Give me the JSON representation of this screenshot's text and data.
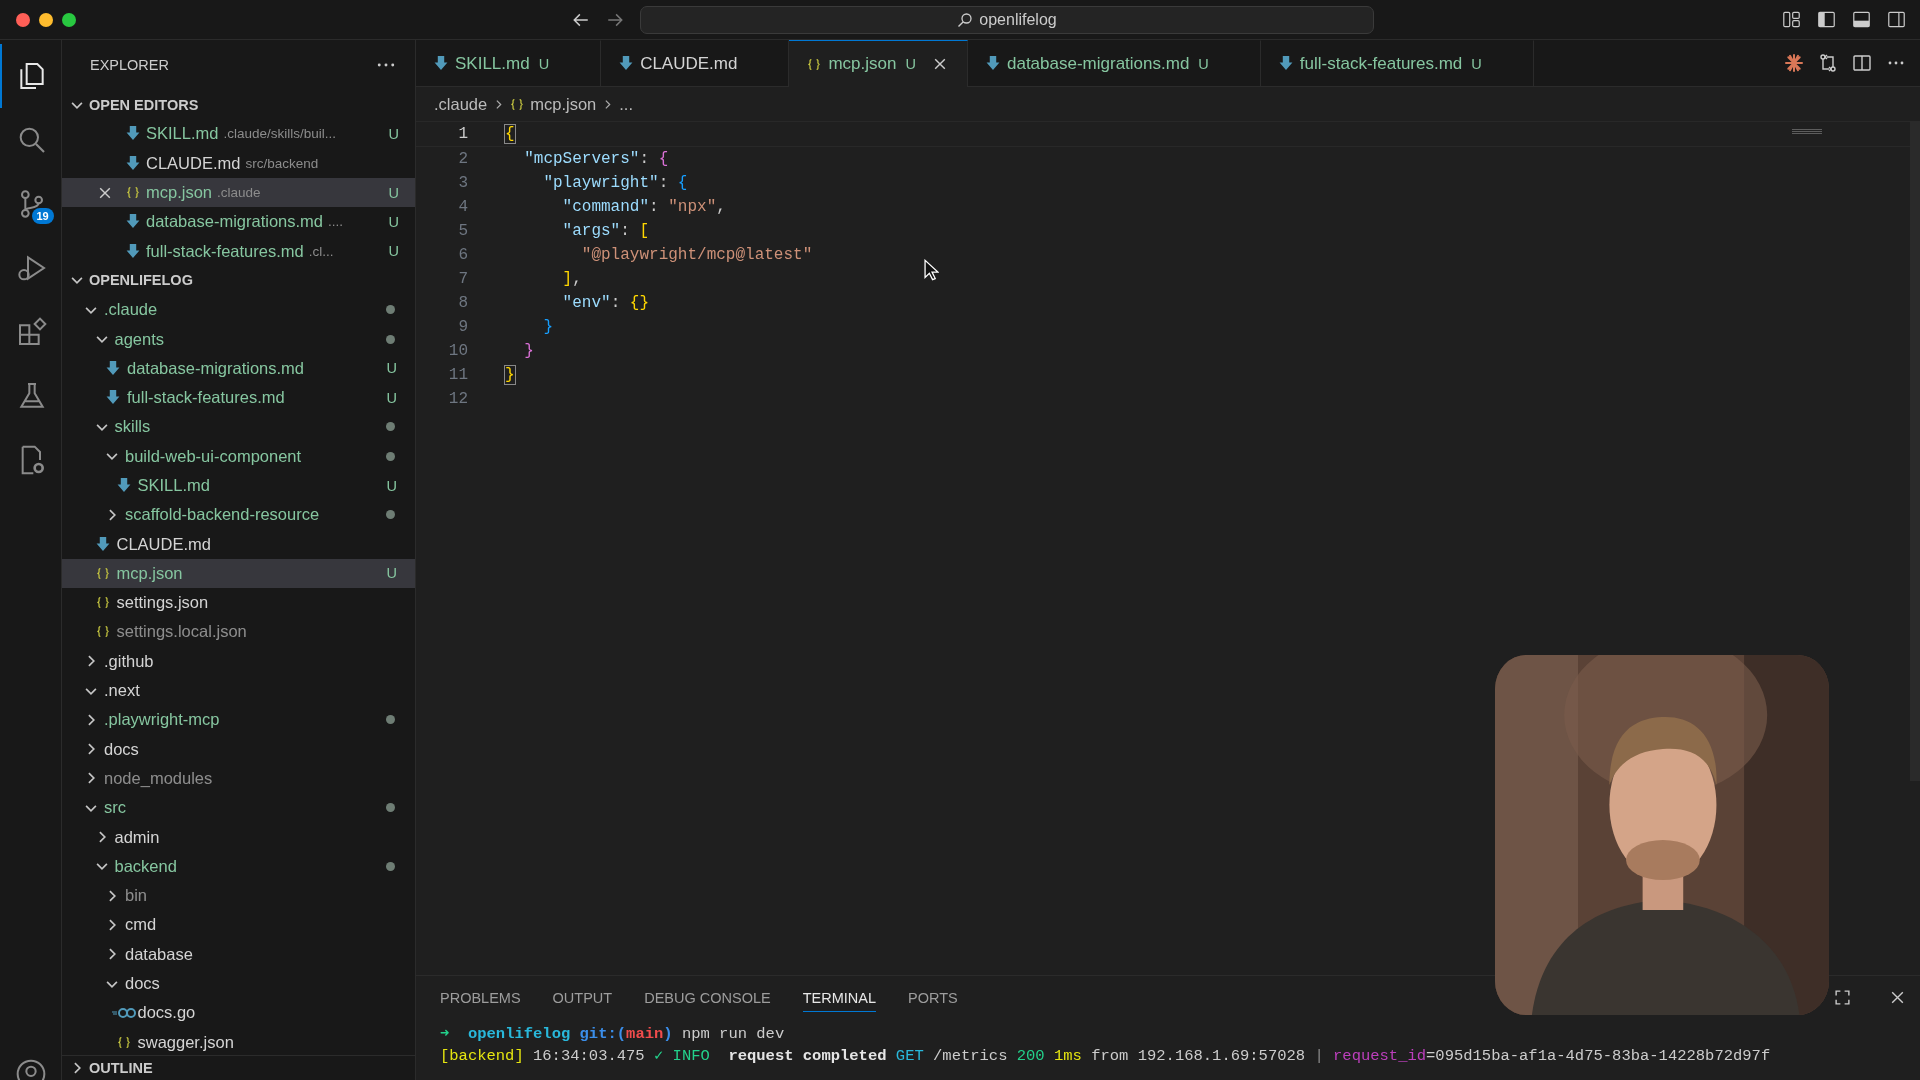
{
  "title_bar": {
    "search": "openlifelog"
  },
  "activity_bar": [
    {
      "kind": "files",
      "selected": true
    },
    {
      "kind": "search",
      "selected": false
    },
    {
      "kind": "source-control",
      "selected": false,
      "badge": "19"
    },
    {
      "kind": "run",
      "selected": false
    },
    {
      "kind": "extensions",
      "selected": false
    },
    {
      "kind": "testing",
      "selected": false
    },
    {
      "kind": "remote",
      "selected": false
    }
  ],
  "sidebar": {
    "title": "EXPLORER",
    "open_editors": {
      "title": "OPEN EDITORS",
      "expanded": true,
      "items": [
        {
          "label": "SKILL.md",
          "kind": "markdown",
          "description": ".claude/skills/buil...",
          "untracked": true,
          "ignored": false,
          "badge": "U",
          "selected": false
        },
        {
          "label": "CLAUDE.md",
          "kind": "markdown",
          "description": "src/backend",
          "untracked": false,
          "ignored": false,
          "selected": false
        },
        {
          "label": "mcp.json",
          "kind": "json",
          "description": ".claude",
          "untracked": true,
          "ignored": false,
          "badge": "U",
          "selected": true
        },
        {
          "label": "database-migrations.md",
          "kind": "markdown",
          "description": "....",
          "untracked": true,
          "ignored": false,
          "badge": "U",
          "selected": false
        },
        {
          "label": "full-stack-features.md",
          "kind": "markdown",
          "description": ".cl...",
          "untracked": true,
          "ignored": false,
          "badge": "U",
          "selected": false
        }
      ]
    },
    "project": {
      "title": "OPENLIFELOG",
      "expanded": true,
      "tree": [
        {
          "label": ".claude",
          "kind": "folder",
          "expanded": true,
          "untracked": true,
          "ignored": false,
          "dot": true,
          "selected": false,
          "children": [
            {
              "label": "agents",
              "kind": "folder",
              "expanded": true,
              "untracked": true,
              "ignored": false,
              "dot": true,
              "selected": false,
              "children": [
                {
                  "label": "database-migrations.md",
                  "kind": "markdown",
                  "untracked": true,
                  "ignored": false,
                  "badge": "U",
                  "selected": false
                },
                {
                  "label": "full-stack-features.md",
                  "kind": "markdown",
                  "untracked": true,
                  "ignored": false,
                  "badge": "U",
                  "selected": false
                }
              ]
            },
            {
              "label": "skills",
              "kind": "folder",
              "expanded": true,
              "untracked": true,
              "ignored": false,
              "dot": true,
              "selected": false,
              "children": [
                {
                  "label": "build-web-ui-component",
                  "kind": "folder",
                  "expanded": true,
                  "untracked": true,
                  "ignored": false,
                  "dot": true,
                  "selected": false,
                  "children": [
                    {
                      "label": "SKILL.md",
                      "kind": "markdown",
                      "untracked": true,
                      "ignored": false,
                      "badge": "U",
                      "selected": false
                    }
                  ]
                },
                {
                  "label": "scaffold-backend-resource",
                  "kind": "folder",
                  "expanded": false,
                  "untracked": true,
                  "ignored": false,
                  "dot": true,
                  "selected": false
                }
              ]
            },
            {
              "label": "CLAUDE.md",
              "kind": "markdown",
              "untracked": false,
              "ignored": false,
              "selected": false
            },
            {
              "label": "mcp.json",
              "kind": "json",
              "untracked": true,
              "ignored": false,
              "badge": "U",
              "selected": true
            },
            {
              "label": "settings.json",
              "kind": "json",
              "untracked": false,
              "ignored": false,
              "selected": false
            },
            {
              "label": "settings.local.json",
              "kind": "json",
              "untracked": false,
              "ignored": true,
              "selected": false
            }
          ]
        },
        {
          "label": ".github",
          "kind": "folder",
          "expanded": false,
          "untracked": false,
          "ignored": false,
          "dot": false,
          "selected": false
        },
        {
          "label": ".next",
          "kind": "folder",
          "expanded": true,
          "untracked": false,
          "ignored": false,
          "dot": false,
          "selected": false
        },
        {
          "label": ".playwright-mcp",
          "kind": "folder",
          "expanded": false,
          "untracked": true,
          "ignored": false,
          "dot": true,
          "selected": false
        },
        {
          "label": "docs",
          "kind": "folder",
          "expanded": false,
          "untracked": false,
          "ignored": false,
          "dot": false,
          "selected": false
        },
        {
          "label": "node_modules",
          "kind": "folder",
          "expanded": false,
          "untracked": false,
          "ignored": true,
          "dot": false,
          "selected": false
        },
        {
          "label": "src",
          "kind": "folder",
          "expanded": true,
          "untracked": true,
          "ignored": false,
          "dot": true,
          "selected": false,
          "children": [
            {
              "label": "admin",
              "kind": "folder",
              "expanded": false,
              "untracked": false,
              "ignored": false,
              "dot": false,
              "selected": false
            },
            {
              "label": "backend",
              "kind": "folder",
              "expanded": true,
              "untracked": true,
              "ignored": false,
              "dot": true,
              "selected": false,
              "children": [
                {
                  "label": "bin",
                  "kind": "folder",
                  "expanded": false,
                  "untracked": false,
                  "ignored": true,
                  "dot": false,
                  "selected": false
                },
                {
                  "label": "cmd",
                  "kind": "folder",
                  "expanded": false,
                  "untracked": false,
                  "ignored": false,
                  "dot": false,
                  "selected": false
                },
                {
                  "label": "database",
                  "kind": "folder",
                  "expanded": false,
                  "untracked": false,
                  "ignored": false,
                  "dot": false,
                  "selected": false
                },
                {
                  "label": "docs",
                  "kind": "folder",
                  "expanded": true,
                  "untracked": false,
                  "ignored": false,
                  "dot": false,
                  "selected": false,
                  "children": [
                    {
                      "label": "docs.go",
                      "kind": "go",
                      "untracked": false,
                      "ignored": false,
                      "selected": false
                    },
                    {
                      "label": "swagger.json",
                      "kind": "json",
                      "untracked": false,
                      "ignored": false,
                      "selected": false
                    }
                  ]
                }
              ]
            }
          ]
        }
      ]
    },
    "outline": {
      "title": "OUTLINE",
      "expanded": false
    }
  },
  "tabs": [
    {
      "label": "SKILL.md",
      "kind": "markdown",
      "untracked": true,
      "badge": "U",
      "selected": false
    },
    {
      "label": "CLAUDE.md",
      "kind": "markdown",
      "untracked": false,
      "selected": false
    },
    {
      "label": "mcp.json",
      "kind": "json",
      "untracked": true,
      "badge": "U",
      "selected": true
    },
    {
      "label": "database-migrations.md",
      "kind": "markdown",
      "untracked": true,
      "badge": "U",
      "selected": false
    },
    {
      "label": "full-stack-features.md",
      "kind": "markdown",
      "untracked": true,
      "badge": "U",
      "selected": false
    }
  ],
  "breadcrumb": [
    {
      "label": ".claude",
      "kind": "folder"
    },
    {
      "label": "mcp.json",
      "kind": "json"
    },
    {
      "label": "...",
      "kind": "more"
    }
  ],
  "code": [
    {
      "number": "1",
      "active": true,
      "tokens": [
        {
          "text": "{",
          "kind": "bracket1",
          "matched": true
        }
      ]
    },
    {
      "number": "2",
      "active": false,
      "tokens": [
        {
          "text": "  \"mcpServers\"",
          "kind": "key"
        },
        {
          "text": ": ",
          "kind": "punct"
        },
        {
          "text": "{",
          "kind": "bracket2"
        }
      ]
    },
    {
      "number": "3",
      "active": false,
      "tokens": [
        {
          "text": "    \"playwright\"",
          "kind": "key"
        },
        {
          "text": ": ",
          "kind": "punct"
        },
        {
          "text": "{",
          "kind": "bracket3"
        }
      ]
    },
    {
      "number": "4",
      "active": false,
      "tokens": [
        {
          "text": "      \"command\"",
          "kind": "key"
        },
        {
          "text": ": ",
          "kind": "punct"
        },
        {
          "text": "\"npx\"",
          "kind": "string"
        },
        {
          "text": ",",
          "kind": "punct"
        }
      ]
    },
    {
      "number": "5",
      "active": false,
      "tokens": [
        {
          "text": "      \"args\"",
          "kind": "key"
        },
        {
          "text": ": ",
          "kind": "punct"
        },
        {
          "text": "[",
          "kind": "bracket1"
        }
      ]
    },
    {
      "number": "6",
      "active": false,
      "tokens": [
        {
          "text": "        \"@playwright/mcp@latest\"",
          "kind": "string"
        }
      ]
    },
    {
      "number": "7",
      "active": false,
      "tokens": [
        {
          "text": "      ]",
          "kind": "bracket1"
        },
        {
          "text": ",",
          "kind": "punct"
        }
      ]
    },
    {
      "number": "8",
      "active": false,
      "tokens": [
        {
          "text": "      \"env\"",
          "kind": "key"
        },
        {
          "text": ": ",
          "kind": "punct"
        },
        {
          "text": "{}",
          "kind": "bracket1"
        }
      ]
    },
    {
      "number": "9",
      "active": false,
      "tokens": [
        {
          "text": "    }",
          "kind": "bracket3"
        }
      ]
    },
    {
      "number": "10",
      "active": false,
      "tokens": [
        {
          "text": "  }",
          "kind": "bracket2"
        }
      ]
    },
    {
      "number": "11",
      "active": false,
      "tokens": [
        {
          "text": "}",
          "kind": "bracket1",
          "matched": true
        }
      ]
    },
    {
      "number": "12",
      "active": false
    }
  ],
  "panel": {
    "tabs": [
      {
        "label": "PROBLEMS",
        "selected": false
      },
      {
        "label": "OUTPUT",
        "selected": false
      },
      {
        "label": "DEBUG CONSOLE",
        "selected": false
      },
      {
        "label": "TERMINAL",
        "selected": true
      },
      {
        "label": "PORTS",
        "selected": false
      }
    ],
    "terminal": [
      [
        {
          "text": "➜  ",
          "kind": "prompt"
        },
        {
          "text": "openlifelog ",
          "kind": "repo"
        },
        {
          "text": "git:(",
          "kind": "git"
        },
        {
          "text": "main",
          "kind": "branch"
        },
        {
          "text": ")",
          "kind": "git"
        },
        {
          "text": " npm run dev",
          "kind": "plain"
        }
      ],
      [
        {
          "text": "[backend]",
          "kind": "tag"
        },
        {
          "text": " 16:34:03.475 ",
          "kind": "plain"
        },
        {
          "text": "✓ INFO",
          "kind": "ok"
        },
        {
          "text": "  request completed ",
          "kind": "bold"
        },
        {
          "text": "GET",
          "kind": "method"
        },
        {
          "text": " /metrics ",
          "kind": "plain"
        },
        {
          "text": "200",
          "kind": "ok"
        },
        {
          "text": " 1ms",
          "kind": "duration"
        },
        {
          "text": " from 192.168.1.69:57028 ",
          "kind": "plain"
        },
        {
          "text": "| ",
          "kind": "muted"
        },
        {
          "text": "request_id",
          "kind": "field"
        },
        {
          "text": "=095d15ba-af1a-4d75-83ba-14228b72d97f",
          "kind": "plain"
        }
      ]
    ]
  }
}
